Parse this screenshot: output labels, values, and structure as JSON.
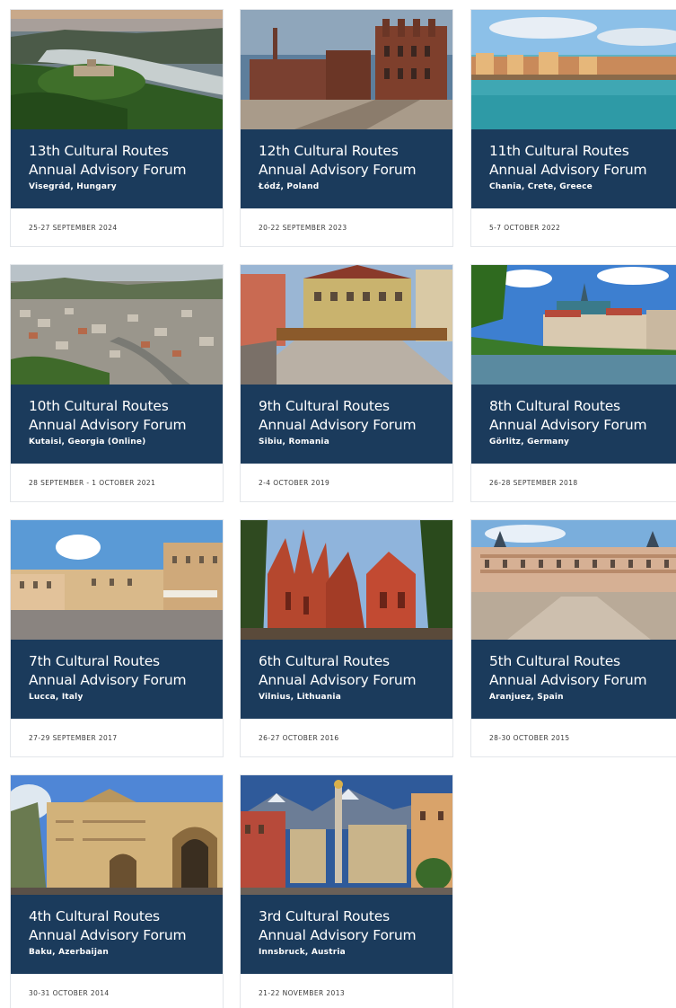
{
  "forums": [
    {
      "title_line1": "13th Cultural Routes",
      "title_line2": "Annual Advisory Forum",
      "location": "Visegrád, Hungary",
      "date": "25-27 SEPTEMBER 2024",
      "photo": "river-hills-photo"
    },
    {
      "title_line1": "12th Cultural Routes",
      "title_line2": "Annual Advisory Forum",
      "location": "Łódź, Poland",
      "date": "20-22 SEPTEMBER 2023",
      "photo": "brick-factory-photo"
    },
    {
      "title_line1": "11th Cultural Routes",
      "title_line2": "Annual Advisory Forum",
      "location": "Chania, Crete, Greece",
      "date": "5-7 OCTOBER 2022",
      "photo": "harbour-photo"
    },
    {
      "title_line1": "10th Cultural Routes",
      "title_line2": "Annual Advisory Forum",
      "location": "Kutaisi, Georgia (Online)",
      "date": "28 SEPTEMBER - 1 OCTOBER 2021",
      "photo": "city-aerial-photo"
    },
    {
      "title_line1": "9th Cultural Routes",
      "title_line2": "Annual Advisory Forum",
      "location": "Sibiu, Romania",
      "date": "2-4 OCTOBER 2019",
      "photo": "old-town-bridge-photo"
    },
    {
      "title_line1": "8th Cultural Routes",
      "title_line2": "Annual Advisory Forum",
      "location": "Görlitz, Germany",
      "date": "26-28 SEPTEMBER 2018",
      "photo": "riverside-town-photo"
    },
    {
      "title_line1": "7th Cultural Routes",
      "title_line2": "Annual Advisory Forum",
      "location": "Lucca, Italy",
      "date": "27-29 SEPTEMBER 2017",
      "photo": "piazza-photo"
    },
    {
      "title_line1": "6th Cultural Routes",
      "title_line2": "Annual Advisory Forum",
      "location": "Vilnius, Lithuania",
      "date": "26-27 OCTOBER 2016",
      "photo": "gothic-church-photo"
    },
    {
      "title_line1": "5th Cultural Routes",
      "title_line2": "Annual Advisory Forum",
      "location": "Aranjuez, Spain",
      "date": "28-30 OCTOBER 2015",
      "photo": "royal-palace-photo"
    },
    {
      "title_line1": "4th Cultural Routes",
      "title_line2": "Annual Advisory Forum",
      "location": "Baku, Azerbaijan",
      "date": "30-31 OCTOBER 2014",
      "photo": "sandstone-gate-photo"
    },
    {
      "title_line1": "3rd Cultural Routes",
      "title_line2": "Annual Advisory Forum",
      "location": "Innsbruck, Austria",
      "date": "21-22 NOVEMBER 2013",
      "photo": "alpine-street-photo"
    }
  ],
  "colors": {
    "panel": "#1b3b5c",
    "card_border": "#e3e6ea",
    "date_text": "#3a3a3a"
  }
}
